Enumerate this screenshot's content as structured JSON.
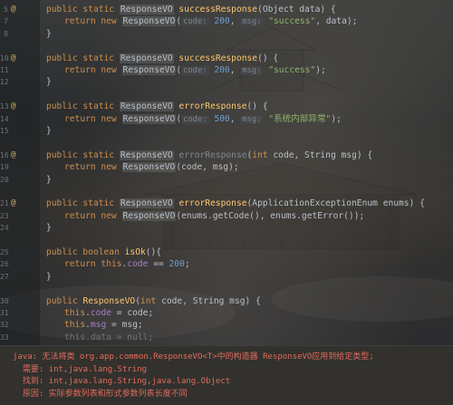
{
  "editor": {
    "lines": [
      {
        "num": "5",
        "marker": "@",
        "indent": 0,
        "tokens": [
          [
            "kw",
            "public static "
          ],
          [
            "cls",
            "ResponseVO"
          ],
          [
            "plain",
            " "
          ],
          [
            "fn",
            "successResponse"
          ],
          [
            "plain",
            "(Object data) {"
          ]
        ]
      },
      {
        "num": "7",
        "marker": "",
        "indent": 1,
        "tokens": [
          [
            "kw",
            "return new "
          ],
          [
            "cls",
            "ResponseVO"
          ],
          [
            "plain",
            "("
          ],
          [
            "hint",
            "code:"
          ],
          [
            "num",
            " 200"
          ],
          [
            "plain",
            ", "
          ],
          [
            "hint",
            "msg:"
          ],
          [
            "str",
            " \"success\""
          ],
          [
            "plain",
            ", data);"
          ]
        ]
      },
      {
        "num": "8",
        "marker": "",
        "indent": 0,
        "tokens": [
          [
            "plain",
            "}"
          ]
        ]
      },
      {
        "num": "",
        "marker": "",
        "indent": 0,
        "tokens": []
      },
      {
        "num": "10",
        "marker": "@",
        "indent": 0,
        "tokens": [
          [
            "kw",
            "public static "
          ],
          [
            "cls",
            "ResponseVO"
          ],
          [
            "plain",
            " "
          ],
          [
            "fn",
            "successResponse"
          ],
          [
            "plain",
            "() {"
          ]
        ]
      },
      {
        "num": "11",
        "marker": "",
        "indent": 1,
        "tokens": [
          [
            "kw",
            "return new "
          ],
          [
            "cls",
            "ResponseVO"
          ],
          [
            "plain",
            "("
          ],
          [
            "hint",
            "code:"
          ],
          [
            "num",
            " 200"
          ],
          [
            "plain",
            ", "
          ],
          [
            "hint",
            "msg:"
          ],
          [
            "str",
            " \"success\""
          ],
          [
            "plain",
            ");"
          ]
        ]
      },
      {
        "num": "12",
        "marker": "",
        "indent": 0,
        "tokens": [
          [
            "plain",
            "}"
          ]
        ]
      },
      {
        "num": "",
        "marker": "",
        "indent": 0,
        "tokens": []
      },
      {
        "num": "13",
        "marker": "@",
        "indent": 0,
        "tokens": [
          [
            "kw",
            "public static "
          ],
          [
            "cls",
            "ResponseVO"
          ],
          [
            "plain",
            " "
          ],
          [
            "fn",
            "errorResponse"
          ],
          [
            "plain",
            "() {"
          ]
        ]
      },
      {
        "num": "14",
        "marker": "",
        "indent": 1,
        "tokens": [
          [
            "kw",
            "return new "
          ],
          [
            "cls",
            "ResponseVO"
          ],
          [
            "plain",
            "("
          ],
          [
            "hint",
            "code:"
          ],
          [
            "num",
            " 500"
          ],
          [
            "plain",
            ", "
          ],
          [
            "hint",
            "msg:"
          ],
          [
            "str",
            " \"系统内部异常\""
          ],
          [
            "plain",
            ");"
          ]
        ]
      },
      {
        "num": "15",
        "marker": "",
        "indent": 0,
        "tokens": [
          [
            "plain",
            "}"
          ]
        ]
      },
      {
        "num": "",
        "marker": "",
        "indent": 0,
        "tokens": []
      },
      {
        "num": "16",
        "marker": "@",
        "indent": 0,
        "tokens": [
          [
            "kw",
            "public static "
          ],
          [
            "cls",
            "ResponseVO"
          ],
          [
            "plain",
            " "
          ],
          [
            "fn-dim",
            "errorResponse"
          ],
          [
            "plain",
            "("
          ],
          [
            "kw",
            "int "
          ],
          [
            "plain",
            "code, String msg) {"
          ]
        ]
      },
      {
        "num": "19",
        "marker": "",
        "indent": 1,
        "tokens": [
          [
            "kw",
            "return new "
          ],
          [
            "cls",
            "ResponseVO"
          ],
          [
            "plain",
            "(code, msg);"
          ]
        ]
      },
      {
        "num": "20",
        "marker": "",
        "indent": 0,
        "tokens": [
          [
            "plain",
            "}"
          ]
        ]
      },
      {
        "num": "",
        "marker": "",
        "indent": 0,
        "tokens": []
      },
      {
        "num": "21",
        "marker": "@",
        "indent": 0,
        "tokens": [
          [
            "kw",
            "public static "
          ],
          [
            "cls",
            "ResponseVO"
          ],
          [
            "plain",
            " "
          ],
          [
            "fn",
            "errorResponse"
          ],
          [
            "plain",
            "(ApplicationExceptionEnum enums) {"
          ]
        ]
      },
      {
        "num": "23",
        "marker": "",
        "indent": 1,
        "tokens": [
          [
            "kw",
            "return new "
          ],
          [
            "cls",
            "ResponseVO"
          ],
          [
            "plain",
            "(enums.getCode(), enums.getError());"
          ]
        ]
      },
      {
        "num": "24",
        "marker": "",
        "indent": 0,
        "tokens": [
          [
            "plain",
            "}"
          ]
        ]
      },
      {
        "num": "",
        "marker": "",
        "indent": 0,
        "tokens": []
      },
      {
        "num": "25",
        "marker": "",
        "indent": 0,
        "tokens": [
          [
            "kw",
            "public boolean "
          ],
          [
            "fn",
            "isOk"
          ],
          [
            "plain",
            "(){"
          ]
        ]
      },
      {
        "num": "26",
        "marker": "",
        "indent": 1,
        "tokens": [
          [
            "kw",
            "return this"
          ],
          [
            "plain",
            "."
          ],
          [
            "field",
            "code"
          ],
          [
            "plain",
            " == "
          ],
          [
            "num",
            "200"
          ],
          [
            "plain",
            ";"
          ]
        ]
      },
      {
        "num": "27",
        "marker": "",
        "indent": 0,
        "tokens": [
          [
            "plain",
            "}"
          ]
        ]
      },
      {
        "num": "",
        "marker": "",
        "indent": 0,
        "tokens": []
      },
      {
        "num": "30",
        "marker": "",
        "indent": 0,
        "tokens": [
          [
            "kw",
            "public "
          ],
          [
            "fn",
            "ResponseVO"
          ],
          [
            "plain",
            "("
          ],
          [
            "kw",
            "int "
          ],
          [
            "plain",
            "code, String msg) {"
          ]
        ]
      },
      {
        "num": "31",
        "marker": "",
        "indent": 1,
        "tokens": [
          [
            "kw",
            "this"
          ],
          [
            "plain",
            "."
          ],
          [
            "field",
            "code"
          ],
          [
            "plain",
            " = code;"
          ]
        ]
      },
      {
        "num": "32",
        "marker": "",
        "indent": 1,
        "tokens": [
          [
            "kw",
            "this"
          ],
          [
            "plain",
            "."
          ],
          [
            "field",
            "msg"
          ],
          [
            "plain",
            " = msg;"
          ]
        ]
      },
      {
        "num": "33",
        "marker": "",
        "indent": 1,
        "tokens": [
          [
            "dim",
            "this.data = null;"
          ]
        ]
      }
    ]
  },
  "console": {
    "lines": [
      "java: 无法将类 org.app.common.ResponseVO<T>中的构造器 ResponseVO应用到给定类型;",
      "  需要: int,java.lang.String",
      "  找到: int,java.lang.String,java.lang.Object",
      "  原因: 实际参数列表和形式参数列表长度不同"
    ]
  },
  "colors": {
    "keyword": "#cf8e4c",
    "method": "#ffc66d",
    "string": "#8fb56b",
    "number": "#6c9fd1",
    "field": "#a77fc4",
    "error": "#e36b5e"
  }
}
